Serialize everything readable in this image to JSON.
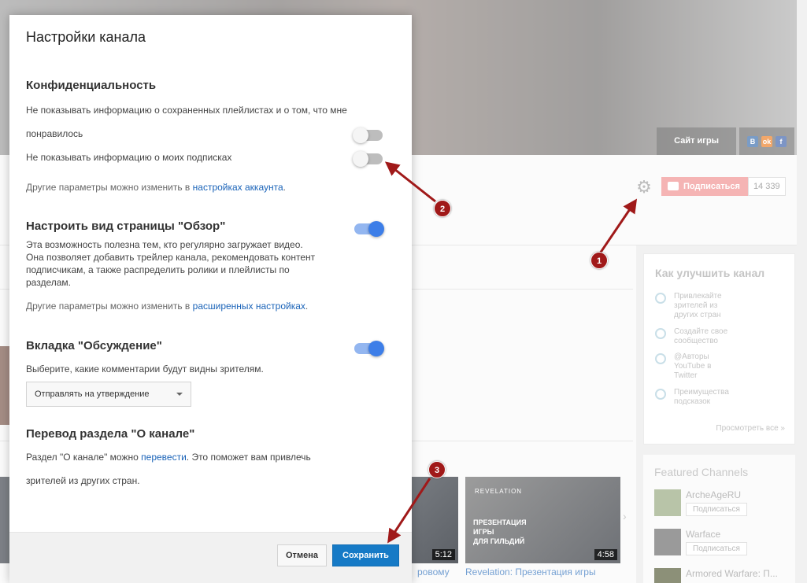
{
  "background": {
    "banner": {
      "site_link": "Сайт игры",
      "social": [
        "В",
        "ok",
        "f"
      ]
    },
    "subscribe": {
      "label": "Подписаться",
      "count": "14 339"
    },
    "improve_card": {
      "title": "Как улучшить канал",
      "items": [
        "Привлекайте зрителей из других стран",
        "Создайте свое сообщество",
        "@Авторы YouTube в Twitter",
        "Преимущества подсказок"
      ],
      "more": "Просмотреть все »"
    },
    "featured": {
      "title": "Featured Channels",
      "channels": [
        {
          "name": "ArcheAgeRU",
          "button": "Подписаться",
          "avatar": "ArcheAge"
        },
        {
          "name": "Warface",
          "button": "Подписаться",
          "avatar": "WAR FACE"
        },
        {
          "name": "Armored Warfare: П...",
          "button": ""
        }
      ]
    },
    "videos": [
      {
        "duration": "5:12",
        "title": "ровому"
      },
      {
        "duration": "4:58",
        "title": "Revelation: Презентация игры",
        "overlay": [
          "ПРЕЗЕНТАЦИЯ",
          "ИГРЫ",
          "ДЛЯ ГИЛЬДИЙ"
        ],
        "logo": "REVELATION"
      }
    ]
  },
  "modal": {
    "title": "Настройки канала",
    "privacy": {
      "heading": "Конфиденциальность",
      "saved_playlists_line1": "Не показывать информацию о сохраненных плейлистах и о том, что мне",
      "saved_playlists_line2": "понравилось",
      "subscriptions": "Не показывать информацию о моих подписках",
      "hint_prefix": "Другие параметры можно изменить в ",
      "hint_link": "настройках аккаунта",
      "hint_suffix": "."
    },
    "browse": {
      "heading": "Настроить вид страницы \"Обзор\"",
      "description": "Эта возможность полезна тем, кто регулярно загружает видео. Она позволяет добавить трейлер канала, рекомендовать контент подписчикам, а также распределить ролики и плейлисты по разделам.",
      "hint_prefix": "Другие параметры можно изменить в ",
      "hint_link": "расширенных настройках",
      "hint_suffix": "."
    },
    "discussion": {
      "heading": "Вкладка \"Обсуждение\"",
      "description": "Выберите, какие комментарии будут видны зрителям.",
      "select_value": "Отправлять на утверждение"
    },
    "about": {
      "heading": "Перевод раздела \"О канале\"",
      "line1_prefix": "Раздел \"О канале\" можно ",
      "line1_link": "перевести",
      "line1_suffix": ". Это поможет вам привлечь",
      "line2": "зрителей из других стран."
    },
    "toggles": {
      "playlists": false,
      "subscriptions": false,
      "browse": true,
      "discussion": true
    },
    "buttons": {
      "cancel": "Отмена",
      "save": "Сохранить"
    }
  },
  "annotations": {
    "badges": [
      "1",
      "2",
      "3"
    ],
    "color": "#a01919"
  }
}
